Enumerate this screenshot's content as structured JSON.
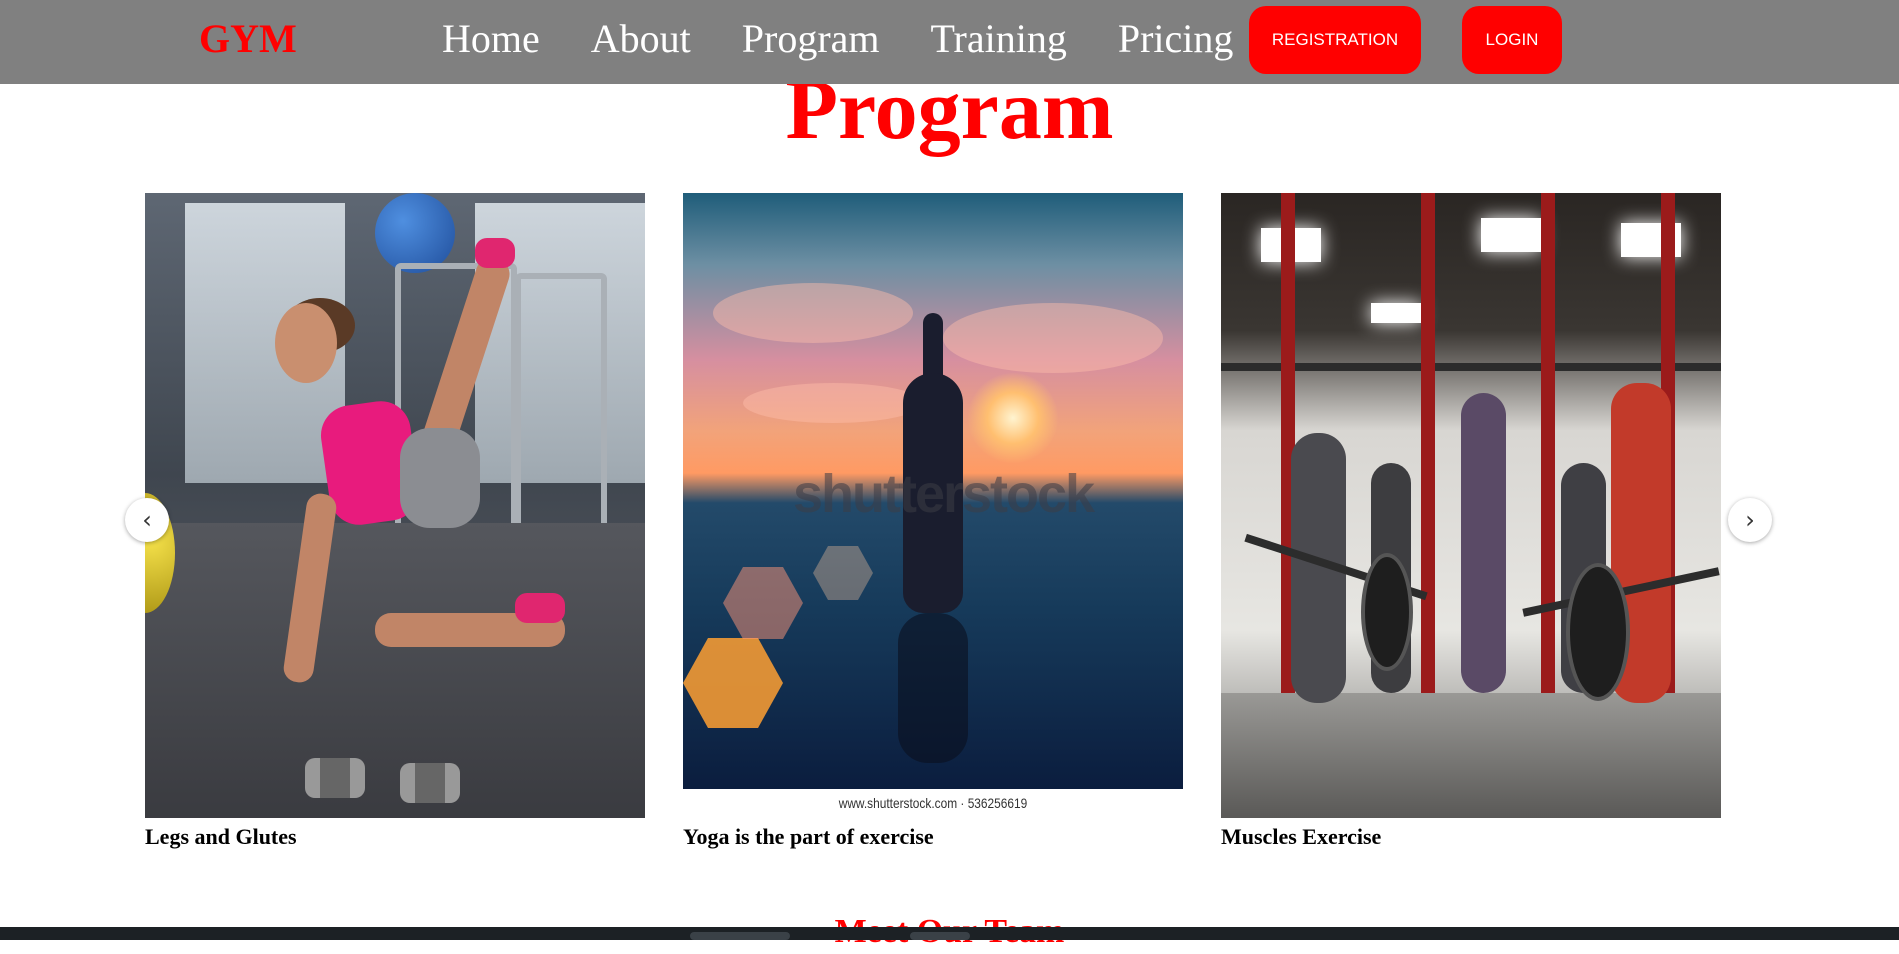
{
  "header": {
    "brand": "GYM",
    "nav": [
      "Home",
      "About",
      "Program",
      "Training",
      "Pricing"
    ],
    "registration_label": "REGISTRATION",
    "login_label": "LOGIN",
    "colors": {
      "bar": "#808080",
      "accent": "#ff0000",
      "text": "#ffffff"
    }
  },
  "program": {
    "title": "Program",
    "cards": [
      {
        "caption": "Legs and Glutes"
      },
      {
        "caption": "Yoga is the part of exercise",
        "watermark": "shutterstock",
        "credit": "www.shutterstock.com · 536256619"
      },
      {
        "caption": "Muscles Exercise"
      }
    ],
    "prev_icon": "‹",
    "next_icon": "›"
  },
  "next_section": {
    "title": "Meet Our Team"
  }
}
